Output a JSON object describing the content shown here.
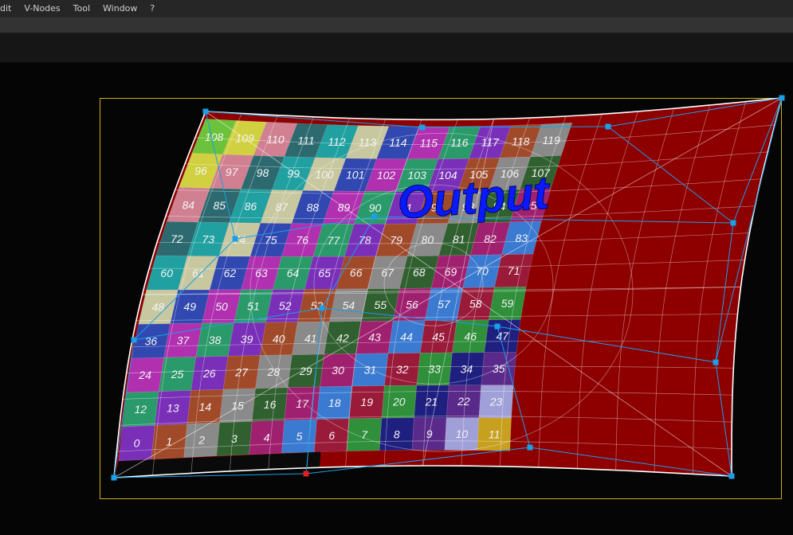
{
  "menu": {
    "items": [
      "dit",
      "V-Nodes",
      "Tool",
      "Window",
      "?"
    ]
  },
  "viewport": {
    "output_label": "Output",
    "tile_count": 120,
    "tile_columns": 12,
    "tile_rows": 10,
    "frame_color": "#c9b217",
    "handle_color": "#1a9fe8",
    "selected_handle_color": "#e02020",
    "fill_color": "#8e0000",
    "label_color": "#0a1aff"
  }
}
